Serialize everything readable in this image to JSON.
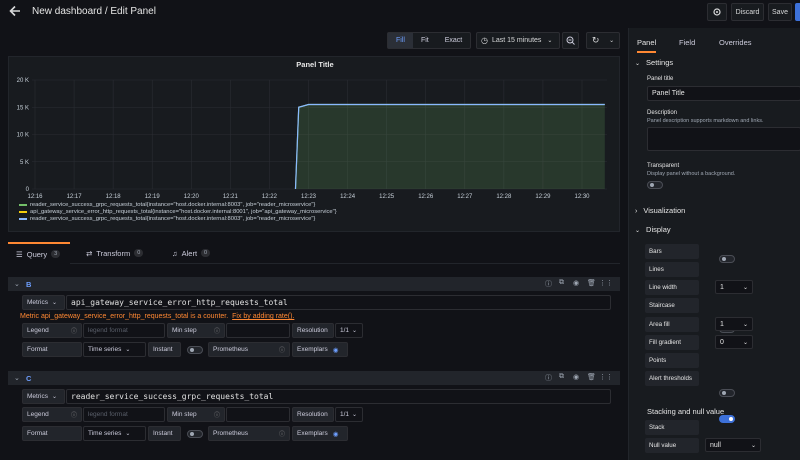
{
  "header": {
    "title": "New dashboard / Edit Panel",
    "discard_label": "Discard",
    "save_label": "Save"
  },
  "toolbar": {
    "view_modes": [
      "Fill",
      "Fit",
      "Exact"
    ],
    "active_view_mode": "Fill",
    "time_range": "Last 15 minutes"
  },
  "panel": {
    "title": "Panel Title",
    "y_ticks": [
      "20 K",
      "15 K",
      "10 K",
      "5 K",
      "0"
    ],
    "x_ticks": [
      "12:16",
      "12:17",
      "12:18",
      "12:19",
      "12:20",
      "12:21",
      "12:22",
      "12:23",
      "12:24",
      "12:25",
      "12:26",
      "12:27",
      "12:28",
      "12:29",
      "12:30"
    ],
    "legend": [
      {
        "label": "reader_service_success_grpc_requests_total{instance=\"host.docker.internal:8003\", job=\"reader_microservice\"}",
        "color": "#73bf69"
      },
      {
        "label": "api_gateway_service_error_http_requests_total{instance=\"host.docker.internal:8001\", job=\"api_gateway_microservice\"}",
        "color": "#f2cc0c"
      },
      {
        "label": "reader_service_success_grpc_requests_total{instance=\"host.docker.internal:8003\", job=\"reader_microservice\"}",
        "color": "#8ab8ff"
      }
    ]
  },
  "chart_data": {
    "type": "line",
    "x": [
      "12:22:40",
      "12:22:45",
      "12:23:00",
      "12:30:35"
    ],
    "series": [
      {
        "name": "reader_service_success_grpc_requests_total{instance=\"host.docker.internal:8003\", job=\"reader_microservice\"}",
        "values": [
          0,
          15000,
          15500,
          15500
        ],
        "color": "#73bf69"
      },
      {
        "name": "reader_service_success_grpc_requests_total{instance=\"host.docker.internal:8003\", job=\"reader_microservice\"}",
        "values": [
          0,
          15000,
          15500,
          15500
        ],
        "color": "#8ab8ff"
      }
    ],
    "ylim": [
      0,
      20000
    ],
    "fill": true,
    "grid": true
  },
  "query_tabs": [
    {
      "label": "Query",
      "count": "3",
      "icon": "database-icon"
    },
    {
      "label": "Transform",
      "count": "0",
      "icon": "transform-icon"
    },
    {
      "label": "Alert",
      "count": "0",
      "icon": "bell-icon"
    }
  ],
  "queries": [
    {
      "name": "B",
      "metrics_label": "Metrics",
      "metric": "api_gateway_service_error_http_requests_total",
      "warning": "Metric api_gateway_service_error_http_requests_total is a counter.",
      "warning_link": "Fix by adding rate().",
      "legend_label": "Legend",
      "legend_placeholder": "legend format",
      "min_step_label": "Min step",
      "resolution_label": "Resolution",
      "resolution": "1/1",
      "format_label": "Format",
      "format": "Time series",
      "instant_label": "Instant",
      "prometheus_label": "Prometheus",
      "exemplars_label": "Exemplars"
    },
    {
      "name": "C",
      "metrics_label": "Metrics",
      "metric": "reader_service_success_grpc_requests_total",
      "legend_label": "Legend",
      "legend_placeholder": "legend format",
      "min_step_label": "Min step",
      "resolution_label": "Resolution",
      "resolution": "1/1",
      "format_label": "Format",
      "format": "Time series",
      "instant_label": "Instant",
      "prometheus_label": "Prometheus",
      "exemplars_label": "Exemplars"
    }
  ],
  "options": {
    "tabs": [
      "Panel",
      "Field",
      "Overrides"
    ],
    "settings_header": "Settings",
    "panel_title_label": "Panel title",
    "panel_title_value": "Panel Title",
    "description_label": "Description",
    "description_hint": "Panel description supports markdown and links.",
    "transparent_label": "Transparent",
    "transparent_hint": "Display panel without a background.",
    "visualization_header": "Visualization",
    "display_header": "Display",
    "bars_label": "Bars",
    "lines_label": "Lines",
    "line_width_label": "Line width",
    "line_width": "1",
    "staircase_label": "Staircase",
    "area_fill_label": "Area fill",
    "area_fill": "1",
    "fill_gradient_label": "Fill gradient",
    "fill_gradient": "0",
    "points_label": "Points",
    "alert_thresholds_label": "Alert thresholds",
    "stacking_header": "Stacking and null value",
    "stack_label": "Stack",
    "null_value_label": "Null value",
    "null_value": "null"
  }
}
